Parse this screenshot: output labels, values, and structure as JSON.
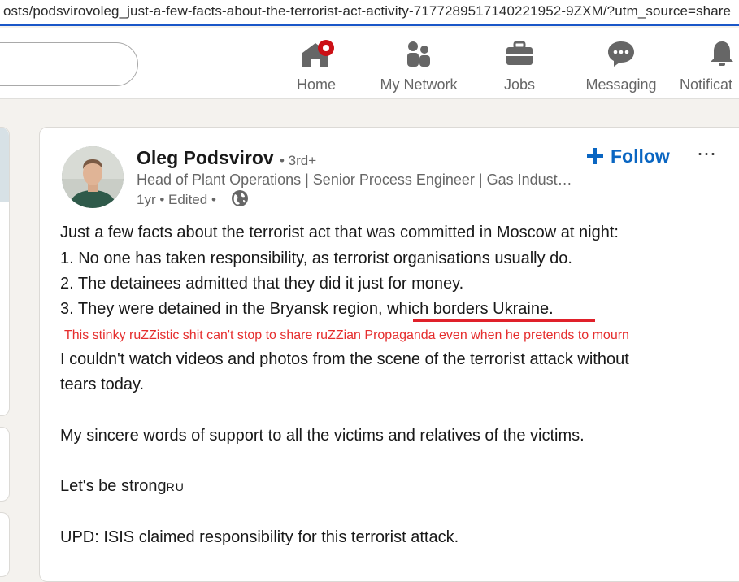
{
  "browser": {
    "url": "osts/podsvirovoleg_just-a-few-facts-about-the-terrorist-act-activity-7177289517140221952-9ZXM/?utm_source=share"
  },
  "nav": {
    "items": [
      {
        "label": "Home",
        "icon": "home-icon",
        "badge": true
      },
      {
        "label": "My Network",
        "icon": "network-icon"
      },
      {
        "label": "Jobs",
        "icon": "briefcase-icon"
      },
      {
        "label": "Messaging",
        "icon": "message-icon"
      },
      {
        "label": "Notificat",
        "icon": "bell-icon"
      }
    ],
    "badge_color": "#cc1016"
  },
  "post": {
    "author": "Oleg Podsvirov",
    "degree": "• 3rd+",
    "headline": "Head of Plant Operations | Senior Process Engineer | Gas Indust…",
    "meta": "1yr • Edited •",
    "follow_label": "Follow",
    "more": "⋯",
    "lines": [
      "Just a few facts about the terrorist act that was committed in Moscow at night:",
      "1. No one has taken responsibility, as terrorist organisations usually do.",
      "2. The detainees admitted that they did it just for money.",
      "3. They were detained in the Bryansk region, which borders Ukraine.",
      "I couldn't watch videos and photos from the scene of the terrorist attack without",
      "tears today.",
      "My sincere words of support to all the victims and relatives of the victims.",
      "Let's be strong",
      "UPD: ISIS claimed responsibility for this terrorist attack."
    ],
    "strong_suffix": "RU",
    "annotation": "This stinky ruZZistic shit can't stop to share ruZZian Propaganda even when he pretends to mourn",
    "annotation_color": "#e52d2d",
    "accent_color": "#0a66c2"
  }
}
